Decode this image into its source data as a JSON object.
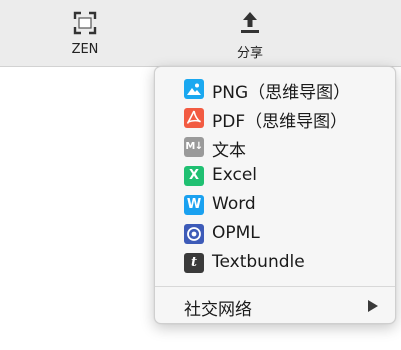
{
  "toolbar": {
    "zen_label": "ZEN",
    "share_label": "分享",
    "zen_icon": "fullscreen-icon",
    "share_icon": "share-upload-icon"
  },
  "menu": {
    "items": [
      {
        "label": "PNG（思维导图）",
        "icon": "image-icon",
        "color": "#1aa8f0"
      },
      {
        "label": "PDF（思维导图）",
        "icon": "pdf-icon",
        "color": "#f25b42"
      },
      {
        "label": "文本",
        "icon": "markdown-icon",
        "color": "#9a9a9a"
      },
      {
        "label": "Excel",
        "icon": "excel-icon",
        "color": "#20c072"
      },
      {
        "label": "Word",
        "icon": "word-icon",
        "color": "#1aa1f0"
      },
      {
        "label": "OPML",
        "icon": "opml-icon",
        "color": "#3d5bb8"
      },
      {
        "label": "Textbundle",
        "icon": "textbundle-icon",
        "color": "#3a3a3a"
      }
    ],
    "social_label": "社交网络"
  }
}
